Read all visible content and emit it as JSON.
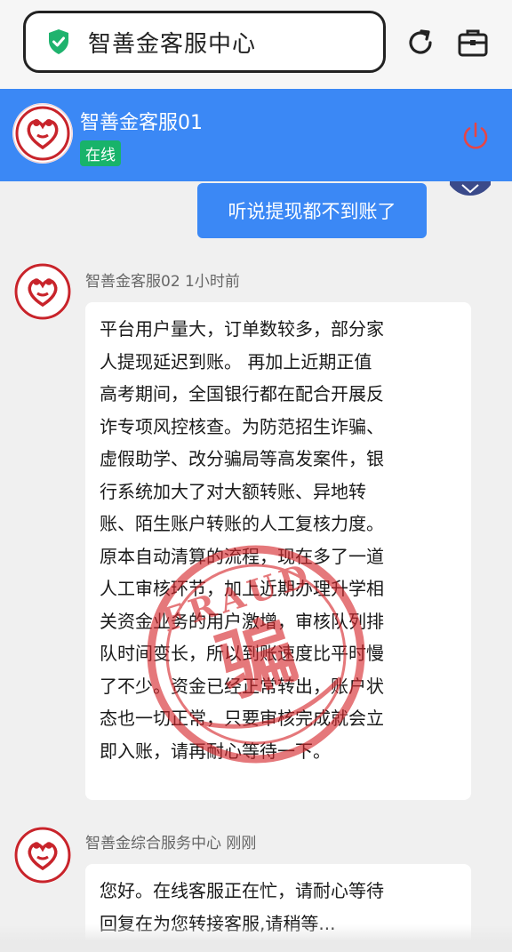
{
  "browser": {
    "url_title": "智善金客服中心",
    "secure_icon": "shield-check-icon",
    "refresh_icon": "refresh-icon",
    "tools_icon": "briefcase-icon"
  },
  "header": {
    "agent_name": "智善金客服01",
    "status": "在线",
    "power_icon": "power-icon",
    "colors": {
      "bar": "#3b88f5",
      "online": "#18b36a",
      "power": "#e64545"
    }
  },
  "messages": {
    "user": {
      "text": "听说提现都不到账了"
    },
    "agent1": {
      "meta": "智善金客服02 1小时前",
      "lines": [
        "平台用户量大，订单数较多，部分家",
        "人提现延迟到账。 再加上近期正值",
        "高考期间，全国银行都在配合开展反",
        "诈专项风控核查。为防范招生诈骗、",
        "虚假助学、改分骗局等高发案件，银",
        "行系统加大了对大额转账、异地转",
        "账、陌生账户转账的人工复核力度。",
        "原本自动清算的流程，现在多了一道",
        "人工审核环节，加上近期办理升学相",
        "关资金业务的用户激增，审核队列排",
        "队时间变长，所以到账速度比平时慢",
        "了不少。资金已经正常转出，账户状",
        "态也一切正常，只要审核完成就会立",
        "即入账，请再耐心等待一下。"
      ]
    },
    "agent2": {
      "meta": "智善金综合服务中心 刚刚",
      "lines": [
        "您好。在线客服正在忙，请耐心等待",
        "回复在为您转接客服,请稍等..."
      ]
    }
  },
  "stamp": {
    "top_text": "FRAUD",
    "center_char": "骗"
  }
}
